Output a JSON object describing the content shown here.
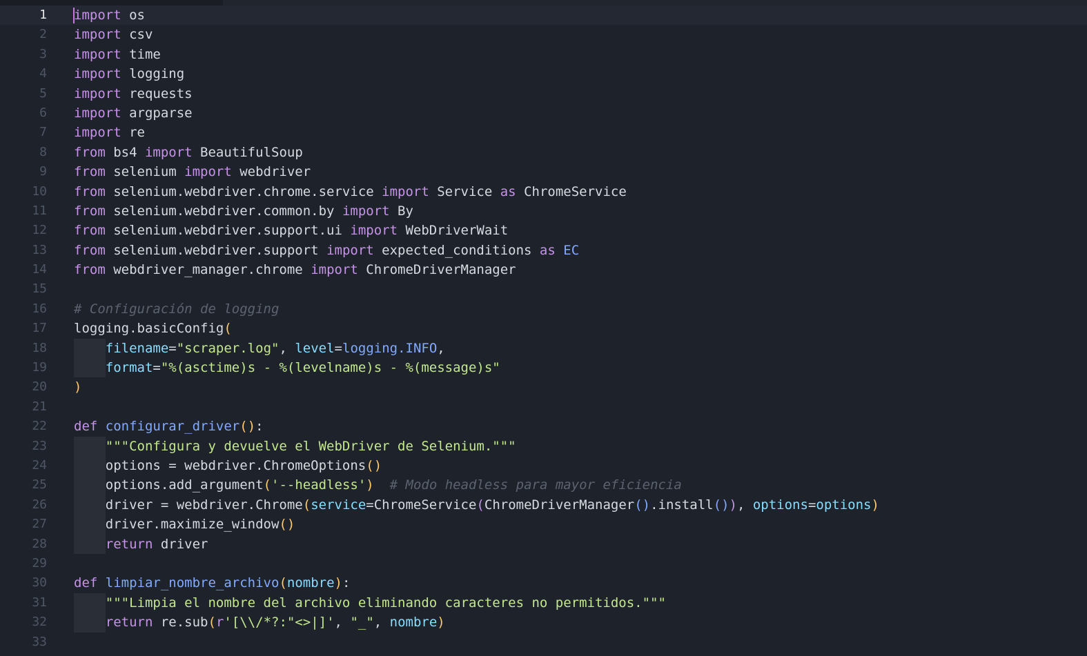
{
  "editor": {
    "language": "python",
    "current_line": "1",
    "lines": [
      {
        "n": "1",
        "tokens": [
          [
            "k",
            "import"
          ],
          [
            "w",
            " os"
          ]
        ]
      },
      {
        "n": "2",
        "tokens": [
          [
            "k",
            "import"
          ],
          [
            "w",
            " csv"
          ]
        ]
      },
      {
        "n": "3",
        "tokens": [
          [
            "k",
            "import"
          ],
          [
            "w",
            " time"
          ]
        ]
      },
      {
        "n": "4",
        "tokens": [
          [
            "k",
            "import"
          ],
          [
            "w",
            " logging"
          ]
        ]
      },
      {
        "n": "5",
        "tokens": [
          [
            "k",
            "import"
          ],
          [
            "w",
            " requests"
          ]
        ]
      },
      {
        "n": "6",
        "tokens": [
          [
            "k",
            "import"
          ],
          [
            "w",
            " argparse"
          ]
        ]
      },
      {
        "n": "7",
        "tokens": [
          [
            "k",
            "import"
          ],
          [
            "w",
            " re"
          ]
        ]
      },
      {
        "n": "8",
        "tokens": [
          [
            "k",
            "from"
          ],
          [
            "w",
            " bs4 "
          ],
          [
            "k",
            "import"
          ],
          [
            "w",
            " BeautifulSoup"
          ]
        ]
      },
      {
        "n": "9",
        "tokens": [
          [
            "k",
            "from"
          ],
          [
            "w",
            " selenium "
          ],
          [
            "k",
            "import"
          ],
          [
            "w",
            " webdriver"
          ]
        ]
      },
      {
        "n": "10",
        "tokens": [
          [
            "k",
            "from"
          ],
          [
            "w",
            " selenium.webdriver.chrome.service "
          ],
          [
            "k",
            "import"
          ],
          [
            "w",
            " Service "
          ],
          [
            "k",
            "as"
          ],
          [
            "w",
            " ChromeService"
          ]
        ]
      },
      {
        "n": "11",
        "tokens": [
          [
            "k",
            "from"
          ],
          [
            "w",
            " selenium.webdriver.common.by "
          ],
          [
            "k",
            "import"
          ],
          [
            "w",
            " By"
          ]
        ]
      },
      {
        "n": "12",
        "tokens": [
          [
            "k",
            "from"
          ],
          [
            "w",
            " selenium.webdriver.support.ui "
          ],
          [
            "k",
            "import"
          ],
          [
            "w",
            " WebDriverWait"
          ]
        ]
      },
      {
        "n": "13",
        "tokens": [
          [
            "k",
            "from"
          ],
          [
            "w",
            " selenium.webdriver.support "
          ],
          [
            "k",
            "import"
          ],
          [
            "w",
            " expected_conditions "
          ],
          [
            "k",
            "as"
          ],
          [
            "f",
            " EC"
          ]
        ]
      },
      {
        "n": "14",
        "tokens": [
          [
            "k",
            "from"
          ],
          [
            "w",
            " webdriver_manager.chrome "
          ],
          [
            "k",
            "import"
          ],
          [
            "w",
            " ChromeDriverManager"
          ]
        ]
      },
      {
        "n": "15",
        "tokens": []
      },
      {
        "n": "16",
        "tokens": [
          [
            "c",
            "# Configuración de logging"
          ]
        ]
      },
      {
        "n": "17",
        "tokens": [
          [
            "w",
            "logging.basicConfig"
          ],
          [
            "p",
            "("
          ]
        ]
      },
      {
        "n": "18",
        "indent": true,
        "tokens": [
          [
            "w",
            "    "
          ],
          [
            "a",
            "filename"
          ],
          [
            "w",
            "="
          ],
          [
            "s",
            "\"scraper.log\""
          ],
          [
            "w",
            ", "
          ],
          [
            "a",
            "level"
          ],
          [
            "w",
            "="
          ],
          [
            "f",
            "logging.INFO"
          ],
          [
            "w",
            ","
          ]
        ]
      },
      {
        "n": "19",
        "indent": true,
        "tokens": [
          [
            "w",
            "    "
          ],
          [
            "a",
            "format"
          ],
          [
            "w",
            "="
          ],
          [
            "s",
            "\"%(asctime)s - %(levelname)s - %(message)s\""
          ]
        ]
      },
      {
        "n": "20",
        "tokens": [
          [
            "p",
            ")"
          ]
        ]
      },
      {
        "n": "21",
        "tokens": []
      },
      {
        "n": "22",
        "tokens": [
          [
            "k",
            "def"
          ],
          [
            "w",
            " "
          ],
          [
            "f",
            "configurar_driver"
          ],
          [
            "p",
            "()"
          ],
          [
            "w",
            ":"
          ]
        ]
      },
      {
        "n": "23",
        "indent": true,
        "tokens": [
          [
            "w",
            "    "
          ],
          [
            "s",
            "\"\"\"Configura y devuelve el WebDriver de Selenium.\"\"\""
          ]
        ]
      },
      {
        "n": "24",
        "indent": true,
        "tokens": [
          [
            "w",
            "    options = webdriver.ChromeOptions"
          ],
          [
            "p",
            "()"
          ]
        ]
      },
      {
        "n": "25",
        "indent": true,
        "tokens": [
          [
            "w",
            "    options.add_argument"
          ],
          [
            "p",
            "("
          ],
          [
            "s",
            "'--headless'"
          ],
          [
            "p",
            ")"
          ],
          [
            "w",
            "  "
          ],
          [
            "c",
            "# Modo headless para mayor eficiencia"
          ]
        ]
      },
      {
        "n": "26",
        "indent": true,
        "tokens": [
          [
            "w",
            "    driver = webdriver.Chrome"
          ],
          [
            "p",
            "("
          ],
          [
            "a",
            "service"
          ],
          [
            "w",
            "=ChromeService"
          ],
          [
            "pp",
            "("
          ],
          [
            "w",
            "ChromeDriverManager"
          ],
          [
            "pb",
            "()"
          ],
          [
            "w",
            ".install"
          ],
          [
            "pb",
            "()"
          ],
          [
            "pp",
            ")"
          ],
          [
            "w",
            ", "
          ],
          [
            "a",
            "options"
          ],
          [
            "w",
            "="
          ],
          [
            "a",
            "options"
          ],
          [
            "p",
            ")"
          ]
        ]
      },
      {
        "n": "27",
        "indent": true,
        "tokens": [
          [
            "w",
            "    driver.maximize_window"
          ],
          [
            "p",
            "()"
          ]
        ]
      },
      {
        "n": "28",
        "indent": true,
        "tokens": [
          [
            "w",
            "    "
          ],
          [
            "k",
            "return"
          ],
          [
            "w",
            " driver"
          ]
        ]
      },
      {
        "n": "29",
        "tokens": []
      },
      {
        "n": "30",
        "tokens": [
          [
            "k",
            "def"
          ],
          [
            "w",
            " "
          ],
          [
            "f",
            "limpiar_nombre_archivo"
          ],
          [
            "p",
            "("
          ],
          [
            "a",
            "nombre"
          ],
          [
            "p",
            ")"
          ],
          [
            "w",
            ":"
          ]
        ]
      },
      {
        "n": "31",
        "indent": true,
        "tokens": [
          [
            "w",
            "    "
          ],
          [
            "s",
            "\"\"\"Limpia el nombre del archivo eliminando caracteres no permitidos.\"\"\""
          ]
        ]
      },
      {
        "n": "32",
        "indent": true,
        "tokens": [
          [
            "w",
            "    "
          ],
          [
            "k",
            "return"
          ],
          [
            "w",
            " re.sub"
          ],
          [
            "p",
            "("
          ],
          [
            "k",
            "r"
          ],
          [
            "s",
            "'[\\\\/*?:\"<>|]'"
          ],
          [
            "w",
            ", "
          ],
          [
            "s",
            "\"_\""
          ],
          [
            "w",
            ", "
          ],
          [
            "a",
            "nombre"
          ],
          [
            "p",
            ")"
          ]
        ]
      },
      {
        "n": "33",
        "tokens": []
      }
    ]
  }
}
